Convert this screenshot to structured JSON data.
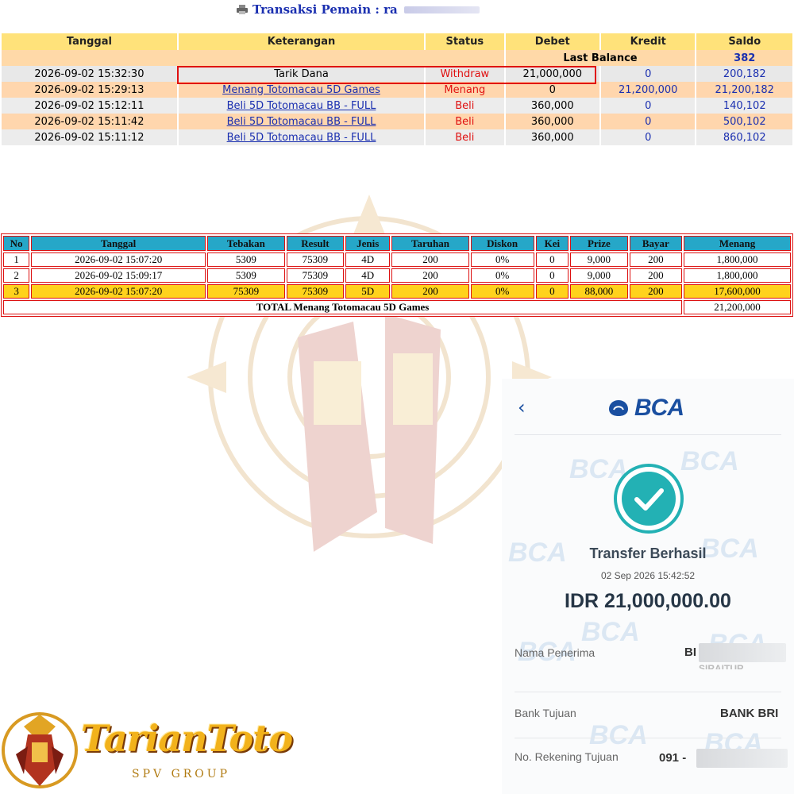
{
  "header": {
    "icon": "printer-icon",
    "title": "Transaksi   Pemain : ra"
  },
  "transactions": {
    "columns": [
      "Tanggal",
      "Keterangan",
      "Status",
      "Debet",
      "Kredit",
      "Saldo"
    ],
    "last_balance_label": "Last Balance",
    "last_balance_value": "382",
    "rows": [
      {
        "tanggal": "2026-09-02 15:32:30",
        "keterangan": "Tarik Dana",
        "status": "Withdraw",
        "debet": "21,000,000",
        "kredit": "0",
        "saldo": "200,182"
      },
      {
        "tanggal": "2026-09-02 15:29:13",
        "keterangan": "Menang Totomacau 5D Games",
        "status": "Menang",
        "debet": "0",
        "kredit": "21,200,000",
        "saldo": "21,200,182"
      },
      {
        "tanggal": "2026-09-02 15:12:11",
        "keterangan": "Beli 5D Totomacau BB - FULL",
        "status": "Beli",
        "debet": "360,000",
        "kredit": "0",
        "saldo": "140,102"
      },
      {
        "tanggal": "2026-09-02 15:11:42",
        "keterangan": "Beli 5D Totomacau BB - FULL",
        "status": "Beli",
        "debet": "360,000",
        "kredit": "0",
        "saldo": "500,102"
      },
      {
        "tanggal": "2026-09-02 15:11:12",
        "keterangan": "Beli 5D Totomacau BB - FULL",
        "status": "Beli",
        "debet": "360,000",
        "kredit": "0",
        "saldo": "860,102"
      }
    ]
  },
  "results": {
    "columns": [
      "No",
      "Tanggal",
      "Tebakan",
      "Result",
      "Jenis",
      "Taruhan",
      "Diskon",
      "Kei",
      "Prize",
      "Bayar",
      "Menang"
    ],
    "rows": [
      {
        "no": "1",
        "tanggal": "2026-09-02 15:07:20",
        "tebakan": "5309",
        "result": "75309",
        "jenis": "4D",
        "taruhan": "200",
        "diskon": "0%",
        "kei": "0",
        "prize": "9,000",
        "bayar": "200",
        "menang": "1,800,000"
      },
      {
        "no": "2",
        "tanggal": "2026-09-02 15:09:17",
        "tebakan": "5309",
        "result": "75309",
        "jenis": "4D",
        "taruhan": "200",
        "diskon": "0%",
        "kei": "0",
        "prize": "9,000",
        "bayar": "200",
        "menang": "1,800,000"
      },
      {
        "no": "3",
        "tanggal": "2026-09-02 15:07:20",
        "tebakan": "75309",
        "result": "75309",
        "jenis": "5D",
        "taruhan": "200",
        "diskon": "0%",
        "kei": "0",
        "prize": "88,000",
        "bayar": "200",
        "menang": "17,600,000"
      }
    ],
    "total_label": "TOTAL  Menang Totomacau 5D Games",
    "total_value": "21,200,000"
  },
  "receipt": {
    "back_icon": "chevron-left-icon",
    "bank_logo_text": "BCA",
    "watermark": "BCA",
    "status": "Transfer Berhasil",
    "datetime": "02 Sep 2026 15:42:52",
    "amount": "IDR 21,000,000.00",
    "recipient_label": "Nama Penerima",
    "recipient_value": "BI",
    "recipient_value2": "SIRAITUR",
    "bank_label": "Bank Tujuan",
    "bank_value": "BANK BRI",
    "account_label": "No. Rekening Tujuan",
    "account_value": "091 -"
  },
  "brand": {
    "name": "TarianToto",
    "tagline": "SPV GROUP"
  },
  "colors": {
    "header_yellow": "#ffe27a",
    "row_orange": "#ffd6ad",
    "link_blue": "#1a2fb0",
    "alert_red": "#e01010",
    "result_header": "#26a7c8",
    "win_row_yellow": "#ffd21c",
    "bca_blue": "#1a4fa0",
    "success_teal": "#23b1b4"
  }
}
